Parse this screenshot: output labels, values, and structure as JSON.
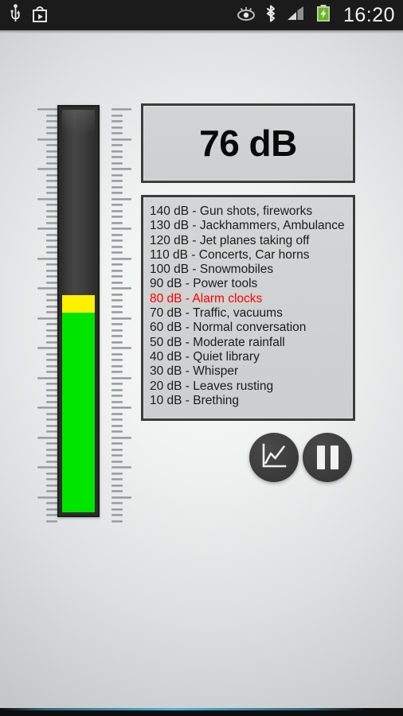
{
  "statusbar": {
    "time": "16:20",
    "left_icons": [
      {
        "name": "usb-icon",
        "label": "USB"
      },
      {
        "name": "play-store-icon",
        "label": "Play Store"
      }
    ],
    "right_icons": [
      {
        "name": "eye-off-icon",
        "label": "Smart stay"
      },
      {
        "name": "bluetooth-icon",
        "label": "Bluetooth"
      },
      {
        "name": "cellular-signal-icon",
        "label": "Signal"
      },
      {
        "name": "battery-charging-icon",
        "label": "Battery charging"
      }
    ]
  },
  "meter": {
    "value_db": 76,
    "min_db": 0,
    "max_db": 140,
    "green_threshold_db": 70,
    "yellow_threshold_db": 85,
    "green_color": "#00E500",
    "yellow_color": "#FFF000",
    "tube_color": "#2D2D2D",
    "tick_count": 70,
    "major_tick_every": 5
  },
  "readout": {
    "value": "76 dB"
  },
  "reference_list": {
    "highlight_color": "#FF0000",
    "items": [
      {
        "text": "140 dB - Gun shots, fireworks",
        "highlighted": false
      },
      {
        "text": "130 dB - Jackhammers, Ambulance",
        "highlighted": false
      },
      {
        "text": "120 dB - Jet planes taking off",
        "highlighted": false
      },
      {
        "text": "110 dB - Concerts, Car horns",
        "highlighted": false
      },
      {
        "text": "100 dB - Snowmobiles",
        "highlighted": false
      },
      {
        "text": "90 dB - Power tools",
        "highlighted": false
      },
      {
        "text": "80 dB - Alarm clocks",
        "highlighted": true
      },
      {
        "text": "70 dB - Traffic, vacuums",
        "highlighted": false
      },
      {
        "text": "60 dB - Normal conversation",
        "highlighted": false
      },
      {
        "text": "50 dB - Moderate rainfall",
        "highlighted": false
      },
      {
        "text": "40 dB - Quiet library",
        "highlighted": false
      },
      {
        "text": "30 dB - Whisper",
        "highlighted": false
      },
      {
        "text": "20 dB - Leaves rusting",
        "highlighted": false
      },
      {
        "text": "10 dB - Brething",
        "highlighted": false
      }
    ]
  },
  "actions": [
    {
      "name": "graph-button",
      "icon": "line-chart-icon",
      "label": "Graph"
    },
    {
      "name": "pause-button",
      "icon": "pause-icon",
      "label": "Pause"
    }
  ],
  "navbar": {
    "accent_color": "#4BB4E0"
  }
}
